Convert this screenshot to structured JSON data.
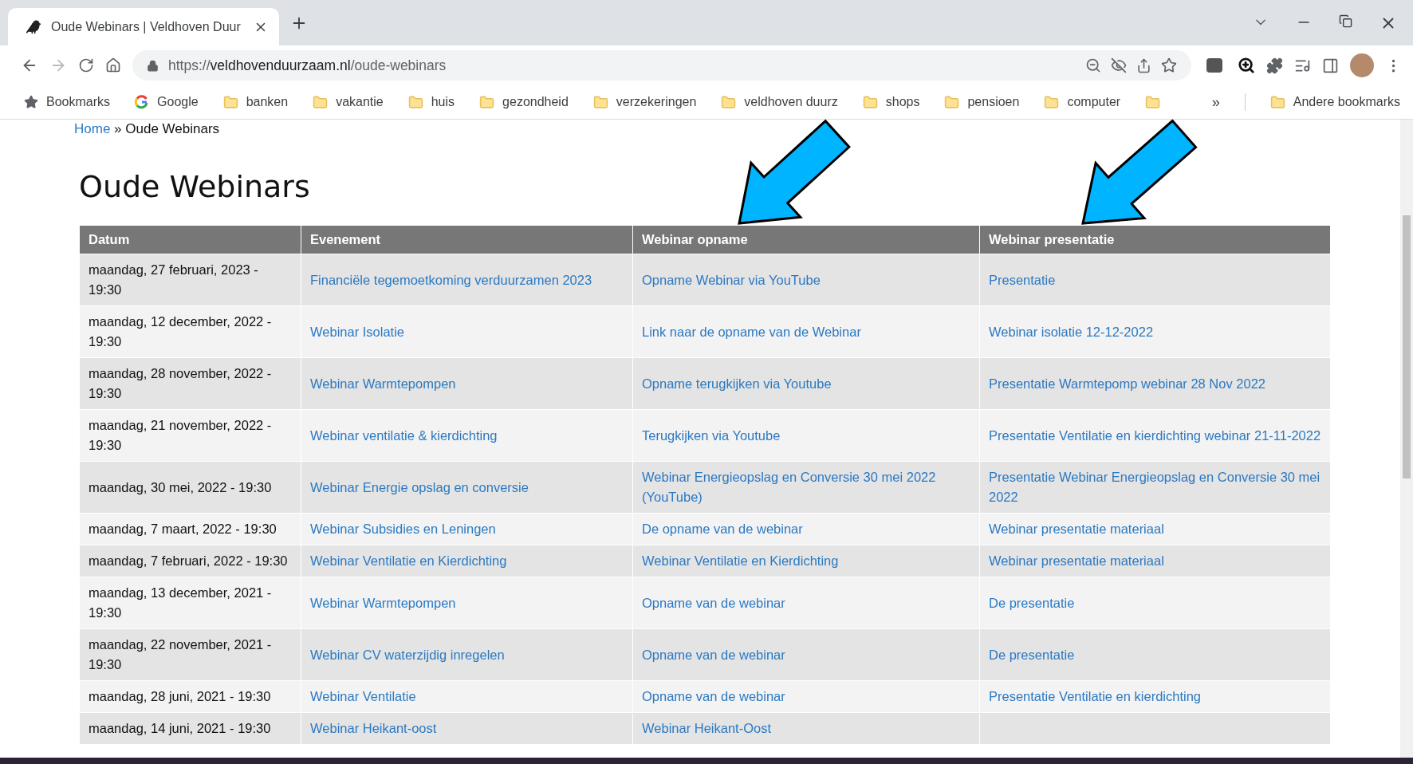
{
  "window": {
    "tab": {
      "title": "Oude Webinars | Veldhoven Duur",
      "selected": true
    },
    "address": {
      "scheme": "https://",
      "host": "veldhovenduurzaam.nl",
      "path": "/oude-webinars"
    }
  },
  "bookmarks": [
    {
      "label": "Bookmarks",
      "kind": "star"
    },
    {
      "label": "Google",
      "kind": "google"
    },
    {
      "label": "banken",
      "kind": "folder"
    },
    {
      "label": "vakantie",
      "kind": "folder"
    },
    {
      "label": "huis",
      "kind": "folder"
    },
    {
      "label": "gezondheid",
      "kind": "folder"
    },
    {
      "label": "verzekeringen",
      "kind": "folder"
    },
    {
      "label": "veldhoven duurz",
      "kind": "folder"
    },
    {
      "label": "shops",
      "kind": "folder"
    },
    {
      "label": "pensioen",
      "kind": "folder"
    },
    {
      "label": "computer",
      "kind": "folder"
    },
    {
      "kind": "folder"
    }
  ],
  "bookmarks_overflow": "»",
  "other_bookmarks": "Andere bookmarks",
  "page": {
    "breadcrumb": {
      "home": "Home",
      "separator": "»",
      "current": "Oude Webinars"
    },
    "title": "Oude Webinars",
    "table": {
      "columns": [
        "Datum",
        "Evenement",
        "Webinar opname",
        "Webinar presentatie"
      ],
      "rows": [
        {
          "date": "maandag, 27 februari, 2023 - 19:30",
          "event": "Financiële tegemoetkoming verduurzamen 2023",
          "recording": "Opname Webinar via YouTube",
          "presentation": "Presentatie"
        },
        {
          "date": "maandag, 12 december, 2022 - 19:30",
          "event": "Webinar Isolatie",
          "recording": "Link naar de opname van de Webinar",
          "presentation": "Webinar isolatie 12-12-2022"
        },
        {
          "date": "maandag, 28 november, 2022 - 19:30",
          "event": "Webinar Warmtepompen",
          "recording": "Opname terugkijken via Youtube",
          "presentation": "Presentatie Warmtepomp webinar 28 Nov 2022"
        },
        {
          "date": "maandag, 21 november, 2022 - 19:30",
          "event": "Webinar ventilatie & kierdichting",
          "recording": "Terugkijken via Youtube",
          "presentation": "Presentatie Ventilatie en kierdichting webinar 21-11-2022"
        },
        {
          "date": "maandag, 30 mei, 2022 - 19:30",
          "event": "Webinar Energie opslag en conversie",
          "recording": "Webinar Energieopslag en Conversie 30 mei 2022 (YouTube)",
          "presentation": "Presentatie Webinar Energieopslag en Conversie 30 mei 2022"
        },
        {
          "date": "maandag, 7 maart, 2022 - 19:30",
          "event": "Webinar Subsidies en Leningen",
          "recording": "De opname van de webinar",
          "presentation": "Webinar presentatie materiaal"
        },
        {
          "date": "maandag, 7 februari, 2022 - 19:30",
          "event": "Webinar Ventilatie en Kierdichting",
          "recording": "Webinar Ventilatie en Kierdichting",
          "presentation": "Webinar presentatie materiaal"
        },
        {
          "date": "maandag, 13 december, 2021 - 19:30",
          "event": "Webinar Warmtepompen",
          "recording": "Opname van de webinar",
          "presentation": "De presentatie"
        },
        {
          "date": "maandag, 22 november, 2021 - 19:30",
          "event": "Webinar CV waterzijdig inregelen",
          "recording": "Opname van de webinar",
          "presentation": "De presentatie"
        },
        {
          "date": "maandag, 28 juni, 2021 - 19:30",
          "event": "Webinar Ventilatie",
          "recording": "Opname van de webinar",
          "presentation": "Presentatie Ventilatie en kierdichting"
        },
        {
          "date": "maandag, 14 juni, 2021 - 19:30",
          "event": "Webinar Heikant-oost",
          "recording": "Webinar Heikant-Oost"
        }
      ]
    }
  },
  "annotations": [
    {
      "kind": "arrow"
    },
    {
      "kind": "arrow"
    }
  ]
}
